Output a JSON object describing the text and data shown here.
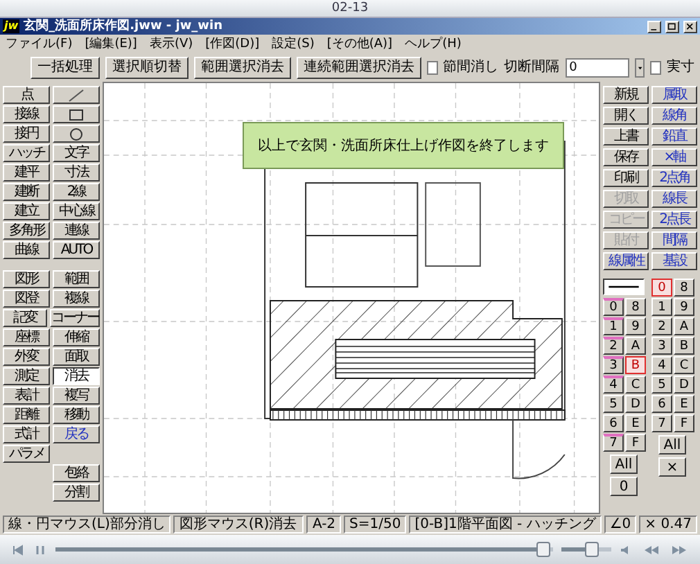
{
  "player": {
    "title": "02-13",
    "seek": {
      "level": 0.98
    },
    "volume": {
      "level": 0.6
    }
  },
  "window": {
    "logo": "jw",
    "title": "玄関_洗面所床作図.jww - jw_win"
  },
  "menu": [
    "ファイル(F)",
    "[編集(E)]",
    "表示(V)",
    "[作図(D)]",
    "設定(S)",
    "[その他(A)]",
    "ヘルプ(H)"
  ],
  "toolbar": {
    "buttons": [
      "一括処理",
      "選択順切替",
      "範囲選択消去",
      "連続範囲選択消去"
    ],
    "check_1": {
      "label": "節間消し",
      "checked": false
    },
    "interval": {
      "label": "切断間隔",
      "value": "0"
    },
    "check_2": {
      "label": "実寸",
      "checked": false
    }
  },
  "message": "以上で玄関・洗面所床仕上げ作図を終了します",
  "left_tool_groups": [
    {
      "rows": [
        [
          {
            "kind": "text",
            "label": "点",
            "selected": false
          },
          {
            "kind": "line",
            "selected": false
          }
        ],
        [
          {
            "kind": "text",
            "label": "接線",
            "selected": false
          },
          {
            "kind": "rect",
            "selected": false
          }
        ],
        [
          {
            "kind": "text",
            "label": "接円",
            "selected": false
          },
          {
            "kind": "circle",
            "selected": false
          }
        ],
        [
          {
            "kind": "text",
            "label": "ハッチ",
            "selected": false
          },
          {
            "kind": "text",
            "label": "文字",
            "selected": false
          }
        ],
        [
          {
            "kind": "text",
            "label": "建平",
            "selected": false
          },
          {
            "kind": "text",
            "label": "寸法",
            "selected": false
          }
        ],
        [
          {
            "kind": "text",
            "label": "建断",
            "selected": false
          },
          {
            "kind": "text",
            "label": "2線",
            "selected": false
          }
        ],
        [
          {
            "kind": "text",
            "label": "建立",
            "selected": false
          },
          {
            "kind": "text",
            "label": "中心線",
            "selected": false
          }
        ],
        [
          {
            "kind": "text",
            "label": "多角形",
            "selected": false
          },
          {
            "kind": "text",
            "label": "連線",
            "selected": false
          }
        ],
        [
          {
            "kind": "text",
            "label": "曲線",
            "selected": false
          },
          {
            "kind": "text",
            "label": "AUTO",
            "selected": false
          }
        ]
      ]
    },
    {
      "rows": [
        [
          {
            "kind": "text",
            "label": "図形",
            "selected": false
          },
          {
            "kind": "text",
            "label": "範囲",
            "selected": false
          }
        ],
        [
          {
            "kind": "text",
            "label": "図登",
            "selected": false
          },
          {
            "kind": "text",
            "label": "複線",
            "selected": false
          }
        ],
        [
          {
            "kind": "text",
            "label": "記変",
            "selected": false
          },
          {
            "kind": "text",
            "label": "コーナー",
            "selected": false
          }
        ],
        [
          {
            "kind": "text",
            "label": "座標",
            "selected": false
          },
          {
            "kind": "text",
            "label": "伸縮",
            "selected": false
          }
        ],
        [
          {
            "kind": "text",
            "label": "外変",
            "selected": false
          },
          {
            "kind": "text",
            "label": "面取",
            "selected": false
          }
        ],
        [
          {
            "kind": "text",
            "label": "測定",
            "selected": false
          },
          {
            "kind": "text",
            "label": "消去",
            "selected": true
          }
        ],
        [
          {
            "kind": "text",
            "label": "表計",
            "selected": false
          },
          {
            "kind": "text",
            "label": "複写",
            "selected": false
          }
        ],
        [
          {
            "kind": "text",
            "label": "距離",
            "selected": false
          },
          {
            "kind": "text",
            "label": "移動",
            "selected": false
          }
        ],
        [
          {
            "kind": "text",
            "label": "式計",
            "selected": false
          },
          {
            "kind": "accent",
            "label": "戻る",
            "selected": false
          }
        ],
        [
          {
            "kind": "text",
            "label": "パラメ",
            "selected": false
          },
          {
            "kind": "blank"
          }
        ],
        [
          {
            "kind": "blank"
          },
          {
            "kind": "text",
            "label": "包絡",
            "selected": false
          }
        ],
        [
          {
            "kind": "blank"
          },
          {
            "kind": "text",
            "label": "分割",
            "selected": false
          }
        ]
      ]
    }
  ],
  "right_tools": [
    [
      {
        "kind": "text",
        "label": "新規",
        "disabled": false
      },
      {
        "kind": "accent",
        "label": "属取",
        "disabled": false
      }
    ],
    [
      {
        "kind": "text",
        "label": "開く",
        "disabled": false
      },
      {
        "kind": "accent",
        "label": "線角",
        "disabled": false
      }
    ],
    [
      {
        "kind": "text",
        "label": "上書",
        "disabled": false
      },
      {
        "kind": "accent",
        "label": "鉛直",
        "disabled": false
      }
    ],
    [
      {
        "kind": "text",
        "label": "保存",
        "disabled": false
      },
      {
        "kind": "accent",
        "label": "×軸",
        "disabled": false
      }
    ],
    [
      {
        "kind": "text",
        "label": "印刷",
        "disabled": false
      },
      {
        "kind": "accent",
        "label": "2点角",
        "disabled": false
      }
    ],
    [
      {
        "kind": "text",
        "label": "切取",
        "disabled": true
      },
      {
        "kind": "accent",
        "label": "線長",
        "disabled": false
      }
    ],
    [
      {
        "kind": "text",
        "label": "コピー",
        "disabled": true
      },
      {
        "kind": "accent",
        "label": "2点長",
        "disabled": false
      }
    ],
    [
      {
        "kind": "text",
        "label": "貼付",
        "disabled": true
      },
      {
        "kind": "accent",
        "label": "間隔",
        "disabled": false
      }
    ],
    [
      {
        "kind": "accent",
        "label": "線属性",
        "disabled": false
      },
      {
        "kind": "accent",
        "label": "基設",
        "disabled": false
      }
    ]
  ],
  "layers": [
    {
      "label": "0",
      "selected": false,
      "has_data": true
    },
    {
      "label": "1",
      "selected": false,
      "has_data": true
    },
    {
      "label": "2",
      "selected": false,
      "has_data": true
    },
    {
      "label": "3",
      "selected": false,
      "has_data": true
    },
    {
      "label": "4",
      "selected": false,
      "has_data": true
    },
    {
      "label": "5",
      "selected": false,
      "has_data": false
    },
    {
      "label": "6",
      "selected": false,
      "has_data": false
    },
    {
      "label": "7",
      "selected": false,
      "has_data": true
    },
    {
      "label": "8",
      "selected": false,
      "has_data": false
    },
    {
      "label": "9",
      "selected": false,
      "has_data": false
    },
    {
      "label": "A",
      "selected": false,
      "has_data": false
    },
    {
      "label": "B",
      "selected": true,
      "has_data": true
    },
    {
      "label": "C",
      "selected": false,
      "has_data": false
    },
    {
      "label": "D",
      "selected": false,
      "has_data": false
    },
    {
      "label": "E",
      "selected": false,
      "has_data": false
    },
    {
      "label": "F",
      "selected": false,
      "has_data": false
    }
  ],
  "layer_buttons": [
    "All",
    "0"
  ],
  "layer_groups": [
    {
      "label": "0",
      "selected": true
    },
    {
      "label": "1",
      "selected": false
    },
    {
      "label": "2",
      "selected": false
    },
    {
      "label": "3",
      "selected": false
    },
    {
      "label": "4",
      "selected": false
    },
    {
      "label": "5",
      "selected": false
    },
    {
      "label": "6",
      "selected": false
    },
    {
      "label": "7",
      "selected": false
    },
    {
      "label": "8",
      "selected": false
    },
    {
      "label": "9",
      "selected": false
    },
    {
      "label": "A",
      "selected": false
    },
    {
      "label": "B",
      "selected": false
    },
    {
      "label": "C",
      "selected": false
    },
    {
      "label": "D",
      "selected": false
    },
    {
      "label": "E",
      "selected": false
    },
    {
      "label": "F",
      "selected": false
    }
  ],
  "group_buttons": [
    "All",
    "×"
  ],
  "status_bar": [
    "線・円マウス(L)部分消し",
    "図形マウス(R)消去",
    "A-2",
    "S=1/50",
    "[0-B]1階平面図 - ハッチング",
    "∠0",
    "× 0.47"
  ]
}
